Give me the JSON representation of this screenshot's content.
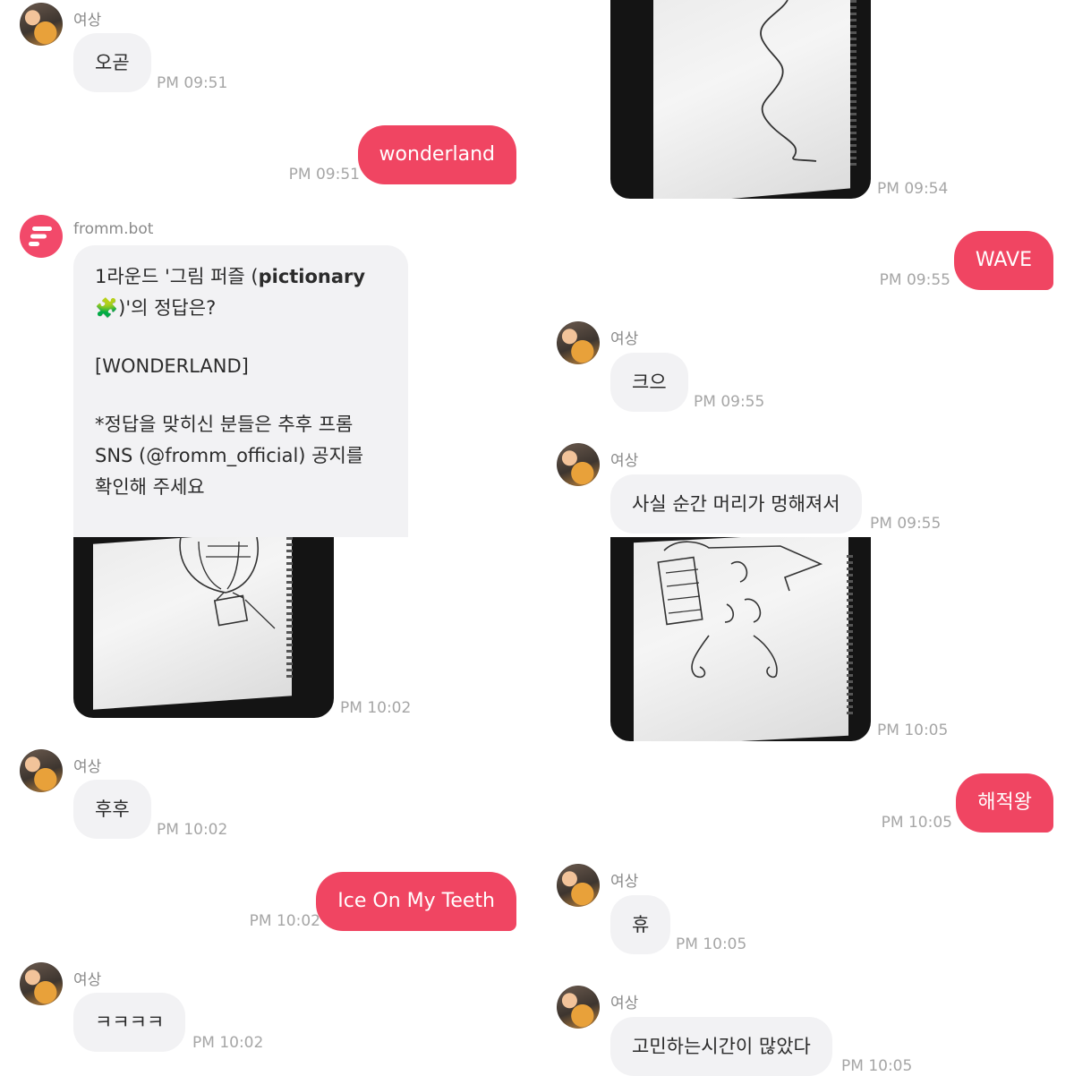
{
  "left": {
    "m1": {
      "sender": "여상",
      "text": "오곧",
      "time": "PM 09:51"
    },
    "m2": {
      "text": "wonderland",
      "time": "PM 09:51"
    },
    "bot": {
      "sender": "fromm.bot",
      "line1_pre": "1라운드 '그림 퍼즐 (",
      "line1_bold": "pictionary",
      "line2_emoji": "🧩",
      "line2_post": ")'의 정답은?",
      "answer": "[WONDERLAND]",
      "note1": "*정답을 맞히신 분들은 추후 프롬",
      "note2": "SNS (@fromm_official) 공지를",
      "note3": "확인해 주세요",
      "photo_time": "PM 10:02",
      "brand_color": "#f2496a"
    },
    "m3": {
      "sender": "여상",
      "text": "후후",
      "time": "PM 10:02"
    },
    "m4": {
      "text": "Ice On My Teeth",
      "time": "PM 10:02"
    },
    "m5": {
      "sender": "여상",
      "text": "ㅋㅋㅋㅋ",
      "time": "PM 10:02"
    }
  },
  "right": {
    "photo1": {
      "time": "PM 09:54"
    },
    "r1": {
      "text": "WAVE",
      "time": "PM 09:55"
    },
    "r2": {
      "sender": "여상",
      "text": "크으",
      "time": "PM 09:55"
    },
    "r3": {
      "sender": "여상",
      "text": "사실 순간 머리가 멍해져서",
      "time": "PM 09:55"
    },
    "photo2": {
      "time": "PM 10:05"
    },
    "r4": {
      "text": "해적왕",
      "time": "PM 10:05"
    },
    "r5": {
      "sender": "여상",
      "text": "휴",
      "time": "PM 10:05"
    },
    "r6": {
      "sender": "여상",
      "text": "고민하는시간이 많았다",
      "time": "PM 10:05"
    }
  },
  "colors": {
    "outgoing_bubble": "#f04562",
    "incoming_bubble": "#f2f2f4",
    "timestamp": "#a6a6a6"
  }
}
